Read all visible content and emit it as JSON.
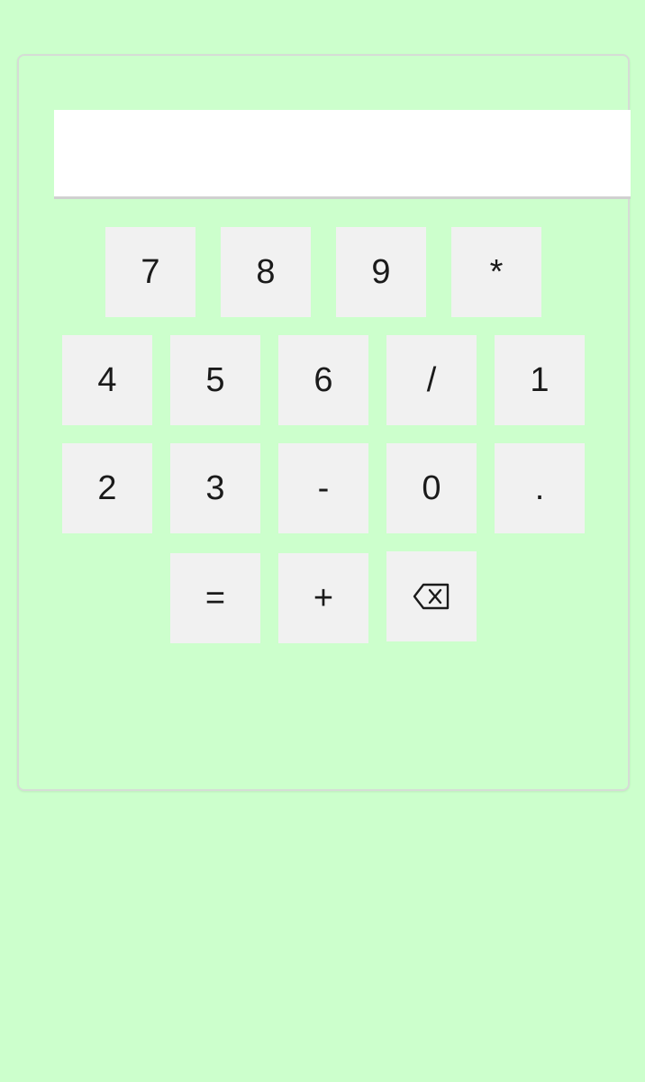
{
  "display": {
    "value": ""
  },
  "keys": {
    "k7": "7",
    "k8": "8",
    "k9": "9",
    "multiply": "*",
    "k4": "4",
    "k5": "5",
    "k6": "6",
    "divide": "/",
    "k1": "1",
    "k2": "2",
    "k3": "3",
    "minus": "-",
    "k0": "0",
    "dot": ".",
    "equals": "=",
    "plus": "+",
    "backspace_icon": "backspace-icon"
  },
  "colors": {
    "background": "#ccffcc",
    "key_background": "#f1f1f1",
    "display_background": "#ffffff"
  }
}
